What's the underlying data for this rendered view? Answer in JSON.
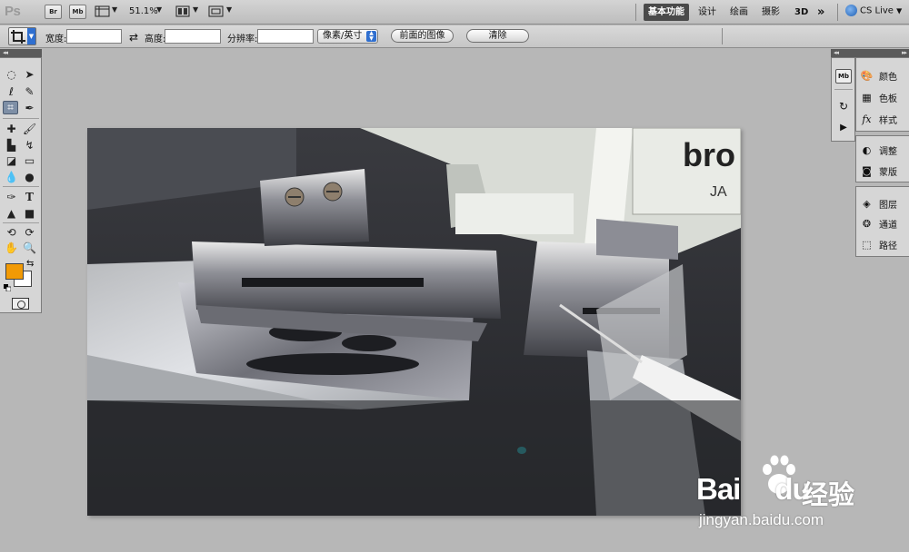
{
  "appbar": {
    "logo": "Ps",
    "bridge_label": "Br",
    "minibridge_label": "Mb",
    "zoom": "51.1%",
    "workspaces": [
      "基本功能",
      "设计",
      "绘画",
      "摄影",
      "3D"
    ],
    "active_workspace": "基本功能",
    "more_label": "»",
    "cslive_label": "CS Live",
    "icons": [
      "view-extras-icon",
      "arrange-documents-icon",
      "screen-mode-icon",
      "cs-live-icon"
    ]
  },
  "options": {
    "width_label": "宽度:",
    "height_label": "高度:",
    "resolution_label": "分辨率:",
    "width_value": "",
    "height_value": "",
    "resolution_value": "",
    "unit": "像素/英寸",
    "front_image_label": "前面的图像",
    "clear_label": "清除"
  },
  "tools": {
    "foreground_color": "#f29a05",
    "background_color": "#ffffff",
    "items": [
      "marquee",
      "move",
      "lasso",
      "quick-selection",
      "crop",
      "eyedropper",
      "spot-healing",
      "brush",
      "clone-stamp",
      "history-brush",
      "eraser",
      "gradient",
      "blur",
      "dodge",
      "pen",
      "type",
      "path-selection",
      "rectangle",
      "3d-rotate",
      "3d-orbit",
      "hand",
      "zoom"
    ],
    "active_tool": "crop"
  },
  "panels": {
    "strip": [
      "Mb"
    ],
    "group1": [
      "颜色",
      "色板",
      "样式"
    ],
    "group2": [
      "调整",
      "蒙版"
    ],
    "group3": [
      "图层",
      "通道",
      "路径"
    ]
  },
  "watermark": {
    "brand": "Bai",
    "brand_suffix": "du",
    "chinese": "经验",
    "url": "jingyan.baidu.com"
  }
}
